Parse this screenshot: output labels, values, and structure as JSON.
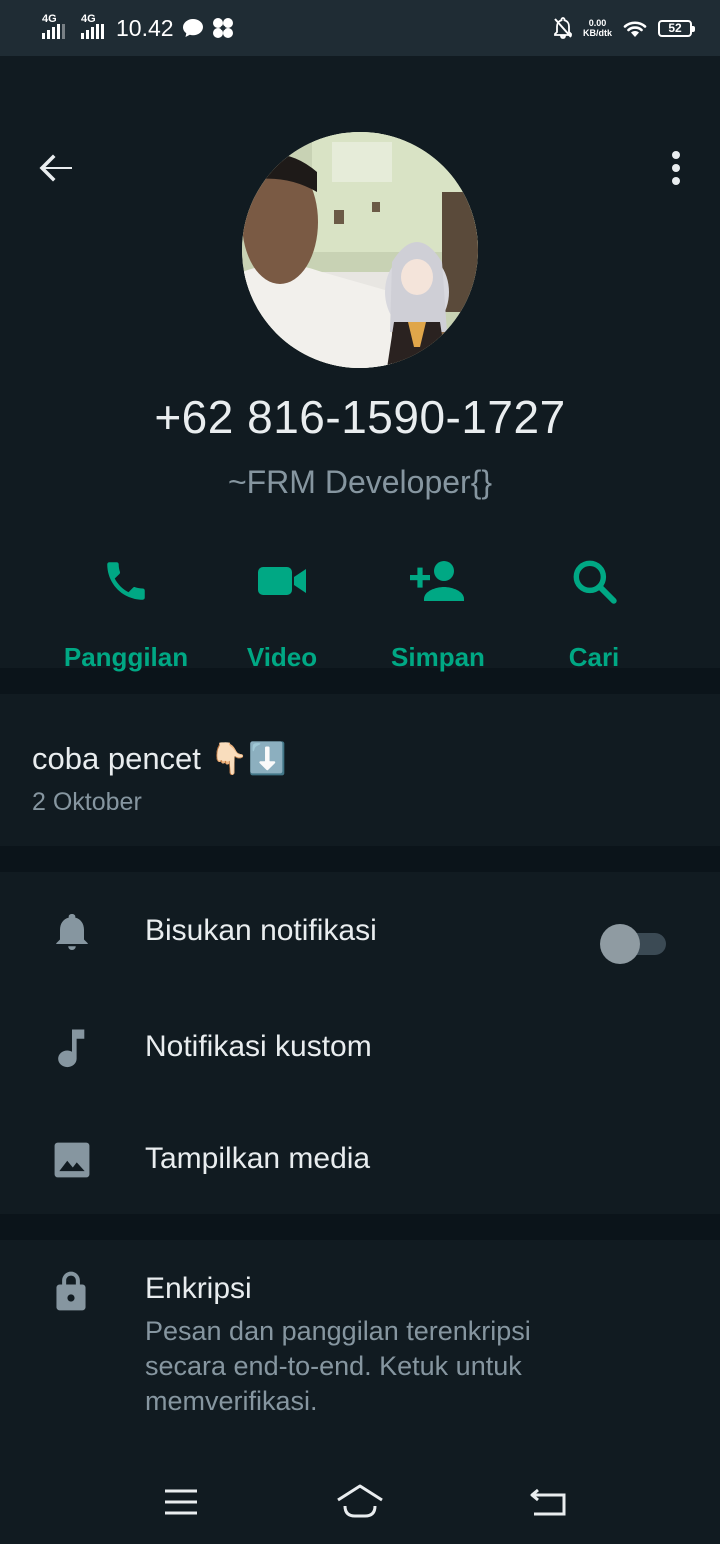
{
  "statusbar": {
    "sim1": "4G",
    "sim2": "4G",
    "time": "10.42",
    "net_speed_value": "0.00",
    "net_speed_unit": "KB/dtk",
    "battery": "52"
  },
  "contact": {
    "phone": "+62 816-1590-1727",
    "about_name": "~FRM Developer{}"
  },
  "actions": [
    {
      "label": "Panggilan",
      "icon": "phone-icon"
    },
    {
      "label": "Video",
      "icon": "video-icon"
    },
    {
      "label": "Simpan",
      "icon": "add-person-icon"
    },
    {
      "label": "Cari",
      "icon": "search-icon"
    }
  ],
  "status": {
    "text": "coba pencet 👇🏻⬇️",
    "date": "2 Oktober"
  },
  "settings": {
    "mute_label": "Bisukan notifikasi",
    "mute_on": false,
    "custom_notif_label": "Notifikasi kustom",
    "media_label": "Tampilkan media"
  },
  "encryption": {
    "title": "Enkripsi",
    "description": "Pesan dan panggilan terenkripsi secara end-to-end. Ketuk untuk memverifikasi."
  },
  "colors": {
    "accent": "#00a884",
    "background": "#111b21",
    "divider": "#0b141a",
    "statusbar": "#1f2c34",
    "secondary_text": "#8696a0"
  }
}
